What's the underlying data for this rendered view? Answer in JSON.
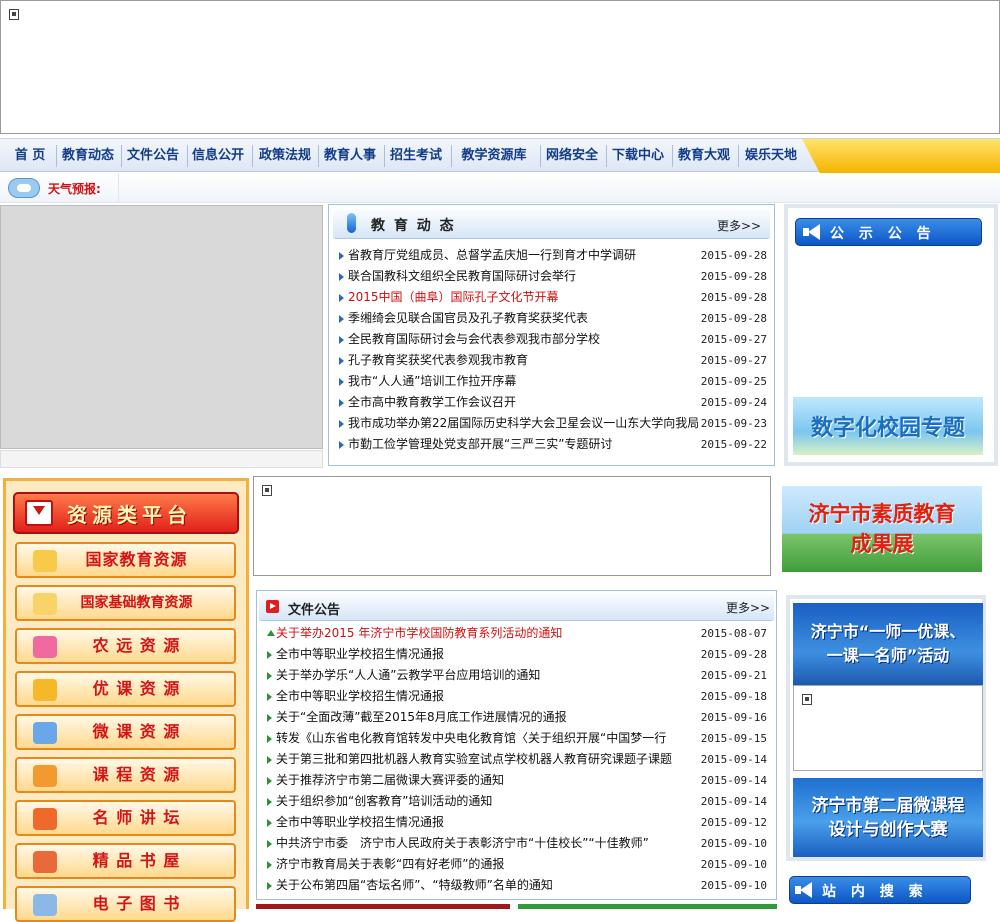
{
  "nav": {
    "items": [
      "首 页",
      "教育动态",
      "文件公告",
      "信息公开",
      "政策法规",
      "教育人事",
      "招生考试",
      "教学资源库",
      "网络安全",
      "下载中心",
      "教育大观",
      "娱乐天地"
    ]
  },
  "weather": {
    "label": "天气预报:"
  },
  "edu_news": {
    "title": "教 育 动 态",
    "more": "更多>>",
    "items": [
      {
        "title": "省教育厅党组成员、总督学孟庆旭一行到育才中学调研",
        "date": "2015-09-28"
      },
      {
        "title": "联合国教科文组织全民教育国际研讨会举行",
        "date": "2015-09-28"
      },
      {
        "title": "2015中国（曲阜）国际孔子文化节开幕",
        "date": "2015-09-28"
      },
      {
        "title": "季缃绮会见联合国官员及孔子教育奖获奖代表",
        "date": "2015-09-28"
      },
      {
        "title": "全民教育国际研讨会与会代表参观我市部分学校",
        "date": "2015-09-27"
      },
      {
        "title": "孔子教育奖获奖代表参观我市教育",
        "date": "2015-09-27"
      },
      {
        "title": "我市“人人通”培训工作拉开序幕",
        "date": "2015-09-25"
      },
      {
        "title": "全市高中教育教学工作会议召开",
        "date": "2015-09-24"
      },
      {
        "title": "我市成功举办第22届国际历史科学大会卫星会议一山东大学向我局",
        "date": "2015-09-23"
      },
      {
        "title": "市勤工俭学管理处党支部开展“三严三实”专题研讨",
        "date": "2015-09-22"
      }
    ]
  },
  "notice_panel": {
    "title": "公 示 公 告"
  },
  "promo_digital": "数字化校园专题",
  "promo_quality": {
    "line1": "济宁市素质教育",
    "line2": "成果展"
  },
  "promo_teacher": {
    "line1": "济宁市“一师一优课、",
    "line2": "一课一名师”活动"
  },
  "promo_micro": {
    "line1": "济宁市第二届微课程",
    "line2": "设计与创作大赛"
  },
  "search_panel": {
    "title": "站 内 搜 索"
  },
  "resources": {
    "header": "资源类平台",
    "items": [
      "国家教育资源",
      "国家基础教育资源",
      "农 远 资 源",
      "优 课 资 源",
      "微 课 资 源",
      "课 程 资 源",
      "名 师 讲 坛",
      "精 品 书 屋",
      "电 子 图 书"
    ]
  },
  "file_notices": {
    "title": "文件公告",
    "more": "更多>>",
    "items": [
      {
        "title": "关于举办2015 年济宁市学校国防教育系列活动的通知",
        "date": "2015-08-07"
      },
      {
        "title": "全市中等职业学校招生情况通报",
        "date": "2015-09-28"
      },
      {
        "title": "关于举办学乐“人人通”云教学平台应用培训的通知",
        "date": "2015-09-21"
      },
      {
        "title": "全市中等职业学校招生情况通报",
        "date": "2015-09-18"
      },
      {
        "title": "关于“全面改薄”截至2015年8月底工作进展情况的通报",
        "date": "2015-09-16"
      },
      {
        "title": "转发《山东省电化教育馆转发中央电化教育馆〈关于组织开展“中国梦一行",
        "date": "2015-09-15"
      },
      {
        "title": "关于第三批和第四批机器人教育实验室试点学校机器人教育研究课题子课题",
        "date": "2015-09-14"
      },
      {
        "title": "关于推荐济宁市第二届微课大赛评委的通知",
        "date": "2015-09-14"
      },
      {
        "title": "关于组织参加“创客教育”培训活动的通知",
        "date": "2015-09-14"
      },
      {
        "title": "全市中等职业学校招生情况通报",
        "date": "2015-09-12"
      },
      {
        "title": "中共济宁市委　济宁市人民政府关于表彰济宁市“十佳校长”“十佳教师”",
        "date": "2015-09-10"
      },
      {
        "title": "济宁市教育局关于表彰“四有好老师”的通报",
        "date": "2015-09-10"
      },
      {
        "title": "关于公布第四届“杏坛名师”、“特级教师”名单的通知",
        "date": "2015-09-10"
      }
    ]
  },
  "colors": {
    "accent": "#123d86",
    "red": "#d01010",
    "orange": "#f4b13a"
  }
}
